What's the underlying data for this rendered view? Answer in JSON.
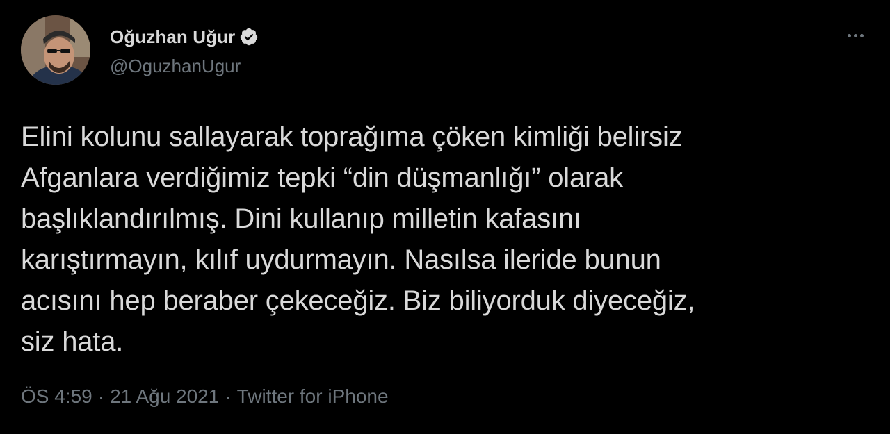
{
  "author": {
    "display_name": "Oğuzhan Uğur",
    "handle": "@OguzhanUgur",
    "verified": true,
    "verified_icon": "verified-badge-icon"
  },
  "menu": {
    "icon": "more-options-icon"
  },
  "tweet": {
    "text": "Elini kolunu sallayarak toprağıma çöken kimliği belirsiz\nAfganlara verdiğimiz tepki “din düşmanlığı” olarak\nbaşlıklandırılmış. Dini kullanıp milletin kafasını\nkarıştırmayın, kılıf uydurmayın. Nasılsa ileride bunun\nacısını hep beraber çekeceğiz. Biz biliyorduk diyeceğiz,\nsiz hata."
  },
  "meta": {
    "time": "ÖS 4:59",
    "separator": "·",
    "date": "21 Ağu 2021",
    "source": "Twitter for iPhone"
  },
  "colors": {
    "background": "#000000",
    "text": "#d9d9d9",
    "muted": "#6e767d",
    "verified": "#d9d9d9"
  }
}
